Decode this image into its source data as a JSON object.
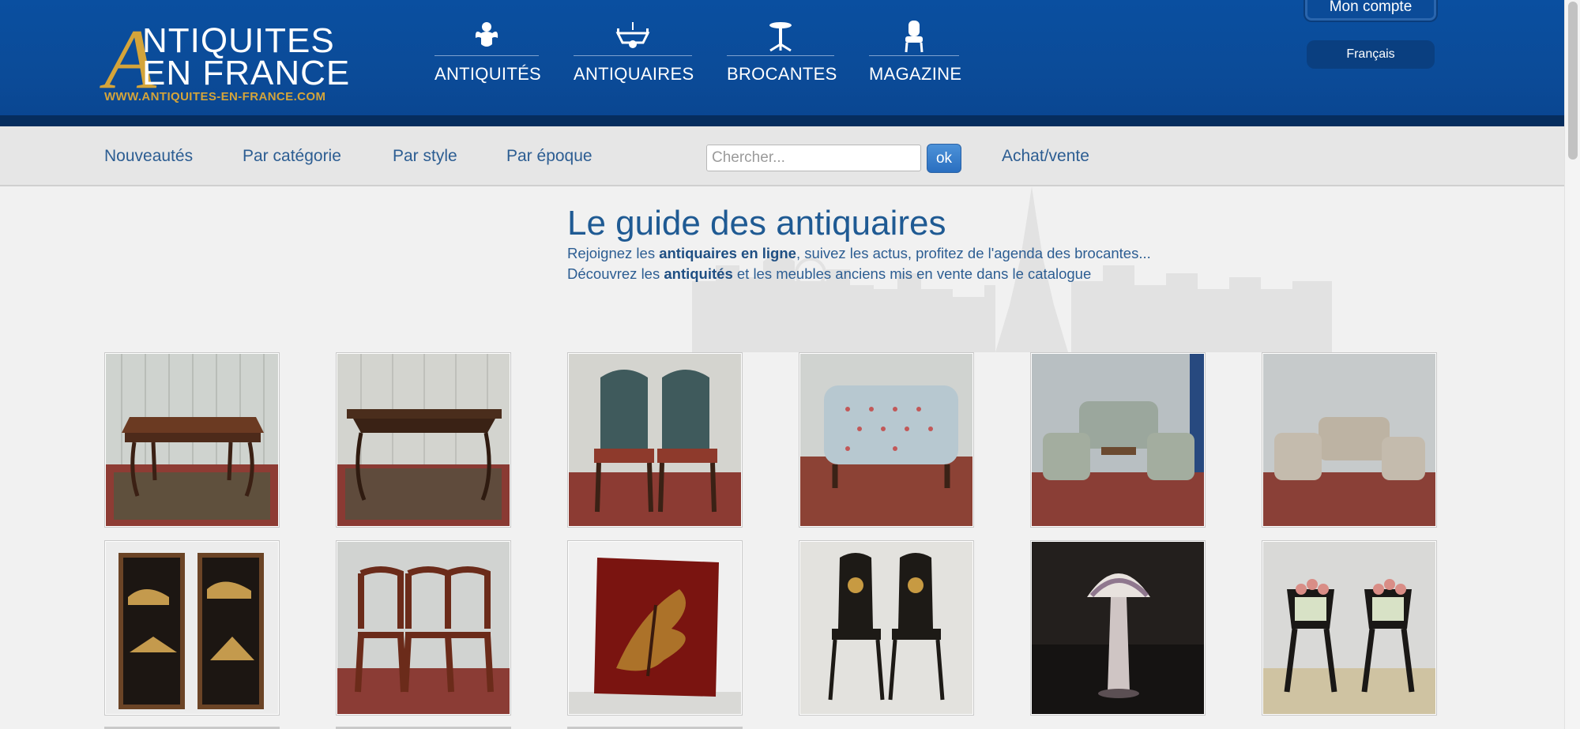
{
  "logo": {
    "letter": "A",
    "line1": "NTIQUITES",
    "line2": "EN FRANCE",
    "url": "WWW.ANTIQUITES-EN-FRANCE.COM"
  },
  "main_nav": [
    {
      "label": "ANTIQUITÉS",
      "icon": "cherub-icon"
    },
    {
      "label": "ANTIQUAIRES",
      "icon": "chandelier-icon"
    },
    {
      "label": "BROCANTES",
      "icon": "pedestal-table-icon"
    },
    {
      "label": "MAGAZINE",
      "icon": "armchair-icon"
    }
  ],
  "account": {
    "label": "Mon compte"
  },
  "language": {
    "label": "Français"
  },
  "subnav": {
    "items": [
      "Nouveautés",
      "Par catégorie",
      "Par style",
      "Par époque"
    ],
    "achat": "Achat/vente"
  },
  "search": {
    "placeholder": "Chercher...",
    "button": "ok"
  },
  "guide": {
    "title": "Le guide des antiquaires",
    "line1_pre": "Rejoignez les ",
    "line1_bold": "antiquaires en ligne",
    "line1_post": ", suivez les actus, profitez de l'agenda des brocantes...",
    "line2_pre": "Découvrez les ",
    "line2_bold": "antiquités",
    "line2_post": " et les meubles anciens mis en vente dans le catalogue"
  },
  "products": [
    {
      "name": "parquetry table on rug"
    },
    {
      "name": "carved wooden console table"
    },
    {
      "name": "pair of upholstered chairs"
    },
    {
      "name": "upholstered daybed"
    },
    {
      "name": "salon sofa and armchairs set"
    },
    {
      "name": "sofa and armchairs set"
    },
    {
      "name": "pair of lacquered panels"
    },
    {
      "name": "set of bistro chairs"
    },
    {
      "name": "red lacquered panel"
    },
    {
      "name": "pair of napoleon III chairs"
    },
    {
      "name": "glass mushroom lamp"
    },
    {
      "name": "pair of ceramic planters on stands"
    }
  ],
  "colors": {
    "header_blue": "#0b4b98",
    "gold": "#d4a43a",
    "link_blue": "#2c5d92",
    "subnav_bg": "#e6e6e6"
  }
}
